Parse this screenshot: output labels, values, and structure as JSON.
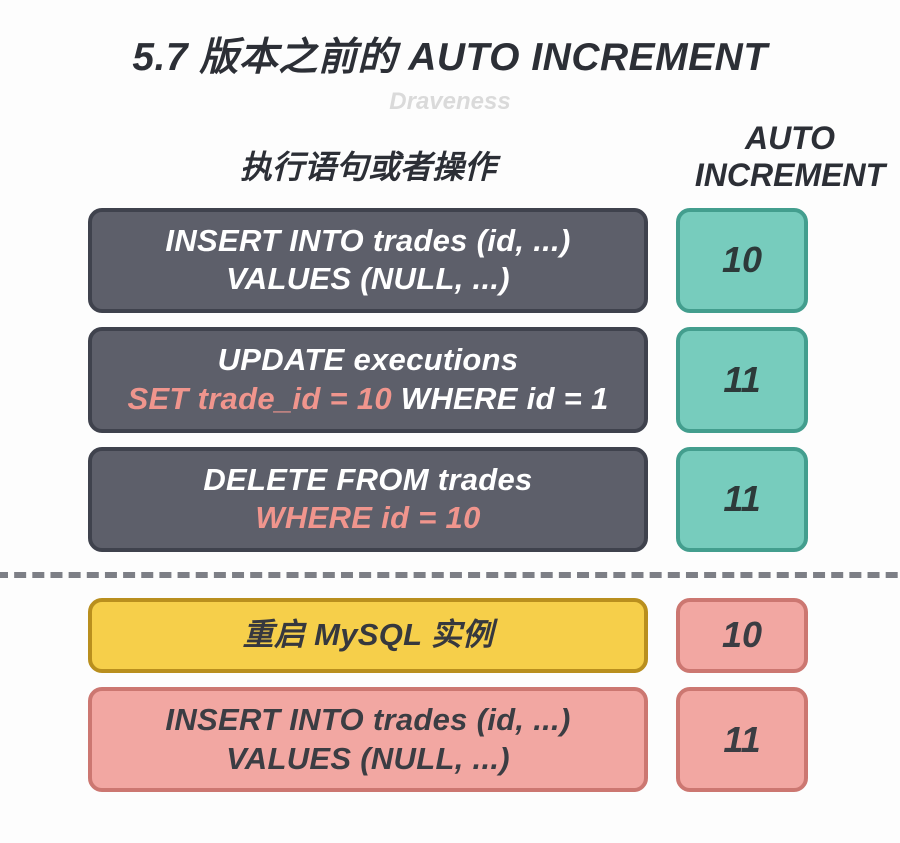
{
  "title": "5.7 版本之前的 AUTO INCREMENT",
  "subtitle": "Draveness",
  "headers": {
    "left": "执行语句或者操作",
    "right_line1": "AUTO",
    "right_line2": "INCREMENT"
  },
  "rows": [
    {
      "op_style": "dark",
      "val_style": "teal",
      "op_line1": "INSERT INTO trades (id, ...)",
      "op_line2": "VALUES (NULL, ...)",
      "op_line2_accent": false,
      "value": "10"
    },
    {
      "op_style": "dark",
      "val_style": "teal",
      "op_line1": "UPDATE executions",
      "op_line2_prefix": "SET trade_id = 10",
      "op_line2_suffix": " WHERE id = 1",
      "op_line2_accent": true,
      "value": "11"
    },
    {
      "op_style": "dark",
      "val_style": "teal",
      "op_line1": "DELETE FROM trades",
      "op_line2": "WHERE id = 10",
      "op_line2_accent_full": true,
      "value": "11"
    }
  ],
  "rows_after": [
    {
      "op_style": "yellow",
      "val_style": "pink",
      "op_single": "重启 MySQL 实例",
      "value": "10",
      "short": true
    },
    {
      "op_style": "pink",
      "val_style": "pink",
      "op_line1": "INSERT INTO trades (id, ...)",
      "op_line2": "VALUES (NULL, ...)",
      "value": "11"
    }
  ]
}
